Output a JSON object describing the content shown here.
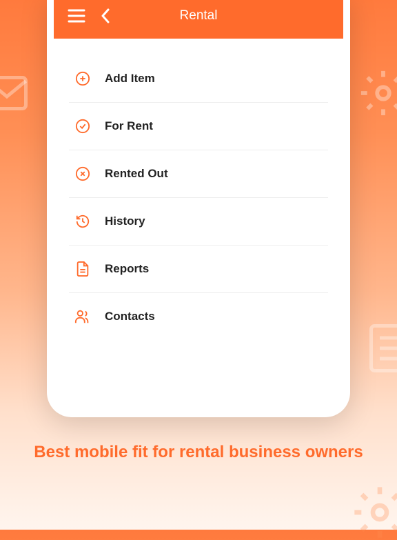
{
  "header": {
    "title": "Rental"
  },
  "menu": {
    "items": [
      {
        "label": "Add Item"
      },
      {
        "label": "For Rent"
      },
      {
        "label": "Rented Out"
      },
      {
        "label": "History"
      },
      {
        "label": "Reports"
      },
      {
        "label": "Contacts"
      }
    ]
  },
  "tagline": "Best mobile fit for rental business owners",
  "colors": {
    "accent": "#ff6b2c"
  }
}
